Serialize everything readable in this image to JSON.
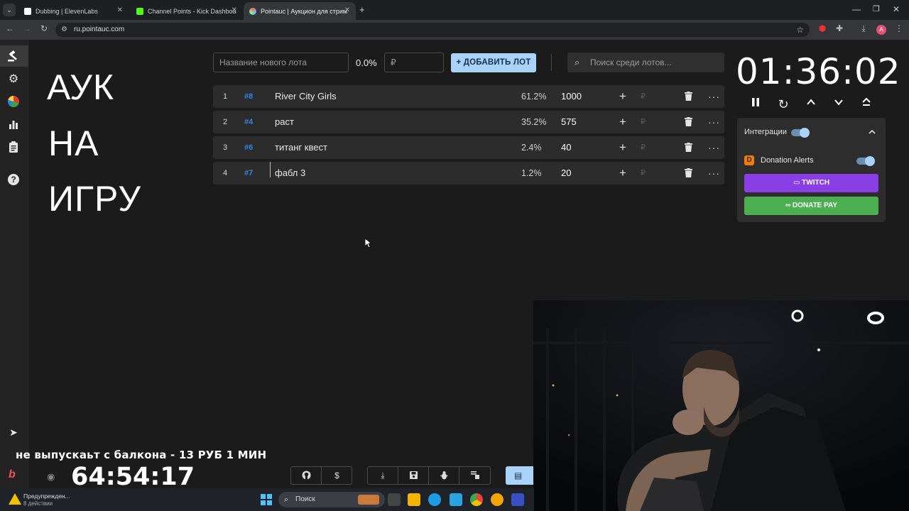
{
  "browser": {
    "tabs": [
      {
        "title": "Dubbing | ElevenLabs",
        "color": "#ffffff"
      },
      {
        "title": "Channel Points - Kick Dashboa",
        "color": "#53fc18"
      },
      {
        "title": "Pointauc | Аукцион для стрима",
        "color": "#ff6b6b"
      }
    ],
    "new_tab": "+",
    "url": "ru.pointauc.com",
    "profile_initial": "A"
  },
  "stream_text": {
    "line1": "АУК",
    "line2": "НА",
    "line3": "ИГРУ"
  },
  "lot_form": {
    "name_placeholder": "Название нового лота",
    "percent": "0.0%",
    "amount_placeholder": "₽",
    "add_button": "ДОБАВИТЬ ЛОТ",
    "search_placeholder": "Поиск среди лотов..."
  },
  "lots": [
    {
      "index": "1",
      "id": "#8",
      "name": "River City Girls",
      "percent": "61.2%",
      "amount": "1000"
    },
    {
      "index": "2",
      "id": "#4",
      "name": "раст",
      "percent": "35.2%",
      "amount": "575"
    },
    {
      "index": "3",
      "id": "#6",
      "name": "титанг квест",
      "percent": "2.4%",
      "amount": "40"
    },
    {
      "index": "4",
      "id": "#7",
      "name": "фабл 3",
      "percent": "1.2%",
      "amount": "20"
    }
  ],
  "row_symbols": {
    "plus": "+",
    "currency": "₽",
    "more": "···"
  },
  "timer": {
    "value": "01:36:02"
  },
  "integrations": {
    "title": "Интеграции",
    "donation_alerts": "Donation Alerts",
    "twitch": "TWITCH",
    "donatepay": "DONATE PAY",
    "colors": {
      "twitch": "#8a3fe6",
      "donatepay": "#4cb050",
      "accent": "#a9d3fb"
    }
  },
  "overlay": {
    "ticker": "не выпускаьт с балкона - 13 РУБ 1 МИН",
    "stream_timer": "64:54:17"
  },
  "taskbar": {
    "warning_title": "Предупрежден...",
    "warning_sub": "8 действии",
    "search": "Поиск"
  }
}
